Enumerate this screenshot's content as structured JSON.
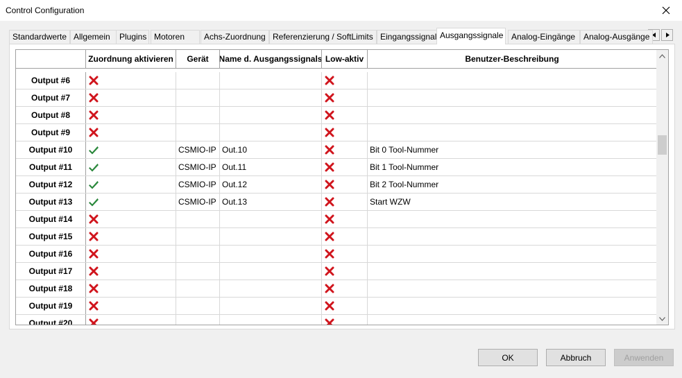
{
  "window": {
    "title": "Control Configuration"
  },
  "tabs": [
    "Standardwerte",
    "Allgemein",
    "Plugins",
    "Motoren",
    "Achs-Zuordnung",
    "Referenzierung / SoftLimits",
    "Eingangssignale",
    "Ausgangssignale",
    "Analog-Eingänge",
    "Analog-Ausgänge"
  ],
  "active_tab": "Ausgangssignale",
  "table": {
    "columns": [
      "",
      "Zuordnung aktivieren",
      "Gerät",
      "Name d. Ausgangssignals",
      "Low-aktiv",
      "Benutzer-Beschreibung"
    ],
    "rows": [
      {
        "label": "Output #6",
        "enabled": false,
        "device": "",
        "signal": "",
        "low_active": false,
        "description": ""
      },
      {
        "label": "Output #7",
        "enabled": false,
        "device": "",
        "signal": "",
        "low_active": false,
        "description": ""
      },
      {
        "label": "Output #8",
        "enabled": false,
        "device": "",
        "signal": "",
        "low_active": false,
        "description": ""
      },
      {
        "label": "Output #9",
        "enabled": false,
        "device": "",
        "signal": "",
        "low_active": false,
        "description": ""
      },
      {
        "label": "Output #10",
        "enabled": true,
        "device": "CSMIO-IP",
        "signal": "Out.10",
        "low_active": false,
        "description": "Bit 0 Tool-Nummer"
      },
      {
        "label": "Output #11",
        "enabled": true,
        "device": "CSMIO-IP",
        "signal": "Out.11",
        "low_active": false,
        "description": "Bit 1 Tool-Nummer"
      },
      {
        "label": "Output #12",
        "enabled": true,
        "device": "CSMIO-IP",
        "signal": "Out.12",
        "low_active": false,
        "description": "Bit 2 Tool-Nummer"
      },
      {
        "label": "Output #13",
        "enabled": true,
        "device": "CSMIO-IP",
        "signal": "Out.13",
        "low_active": false,
        "description": "Start WZW"
      },
      {
        "label": "Output #14",
        "enabled": false,
        "device": "",
        "signal": "",
        "low_active": false,
        "description": ""
      },
      {
        "label": "Output #15",
        "enabled": false,
        "device": "",
        "signal": "",
        "low_active": false,
        "description": ""
      },
      {
        "label": "Output #16",
        "enabled": false,
        "device": "",
        "signal": "",
        "low_active": false,
        "description": ""
      },
      {
        "label": "Output #17",
        "enabled": false,
        "device": "",
        "signal": "",
        "low_active": false,
        "description": ""
      },
      {
        "label": "Output #18",
        "enabled": false,
        "device": "",
        "signal": "",
        "low_active": false,
        "description": ""
      },
      {
        "label": "Output #19",
        "enabled": false,
        "device": "",
        "signal": "",
        "low_active": false,
        "description": ""
      },
      {
        "label": "Output #20",
        "enabled": false,
        "device": "",
        "signal": "",
        "low_active": false,
        "description": ""
      }
    ]
  },
  "buttons": {
    "ok": "OK",
    "cancel": "Abbruch",
    "apply": "Anwenden"
  },
  "icons": {
    "enabled": "green-check-icon",
    "disabled": "red-x-icon"
  },
  "colors": {
    "check": "#2ea043",
    "cross": "#d0141c"
  }
}
